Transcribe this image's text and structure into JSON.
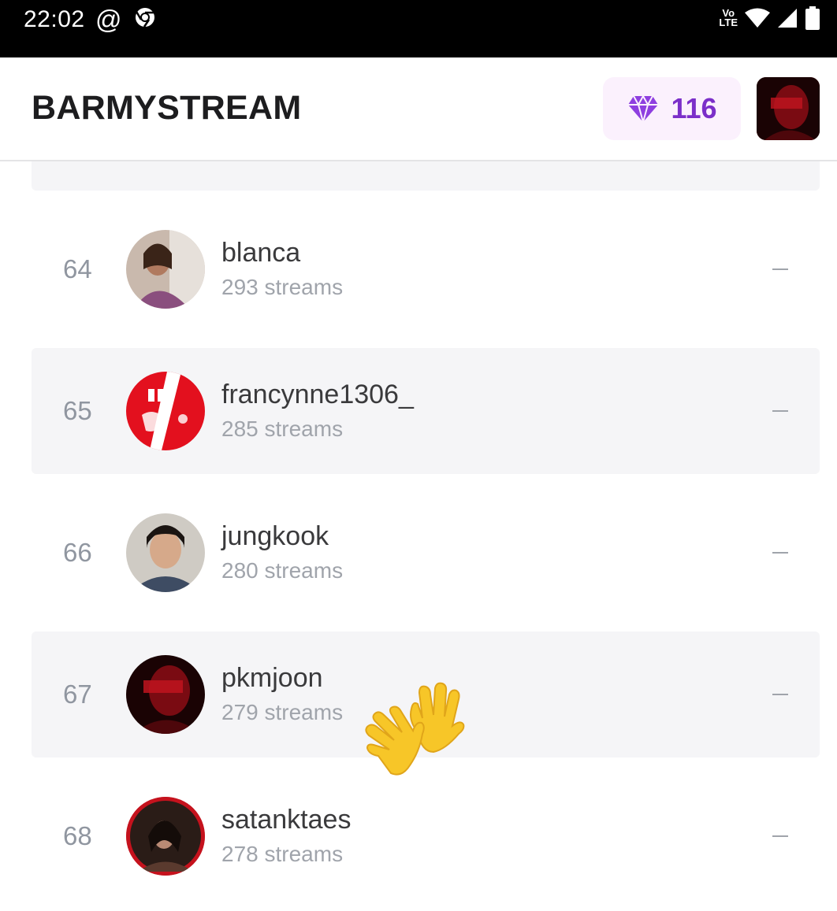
{
  "status_bar": {
    "time": "22:02",
    "at_symbol": "@",
    "network_label_top": "Vo",
    "network_label_bottom": "LTE",
    "icons": [
      "at-icon",
      "chrome-icon",
      "volte-icon",
      "wifi-icon",
      "signal-icon",
      "battery-icon"
    ]
  },
  "header": {
    "title": "BARMYSTREAM",
    "gem_count": "116",
    "gem_icon": "gem-heart-icon",
    "accent_color": "#7b2fc9"
  },
  "leaderboard": {
    "rows": [
      {
        "rank": "64",
        "username": "blanca",
        "streams": "293 streams",
        "change": "–"
      },
      {
        "rank": "65",
        "username": "francynne1306_",
        "streams": "285 streams",
        "change": "–"
      },
      {
        "rank": "66",
        "username": "jungkook",
        "streams": "280 streams",
        "change": "–"
      },
      {
        "rank": "67",
        "username": "pkmjoon",
        "streams": "279 streams",
        "change": "–"
      },
      {
        "rank": "68",
        "username": "satanktaes",
        "streams": "278 streams",
        "change": "–"
      }
    ]
  },
  "overlay": {
    "emoji": "👋"
  }
}
